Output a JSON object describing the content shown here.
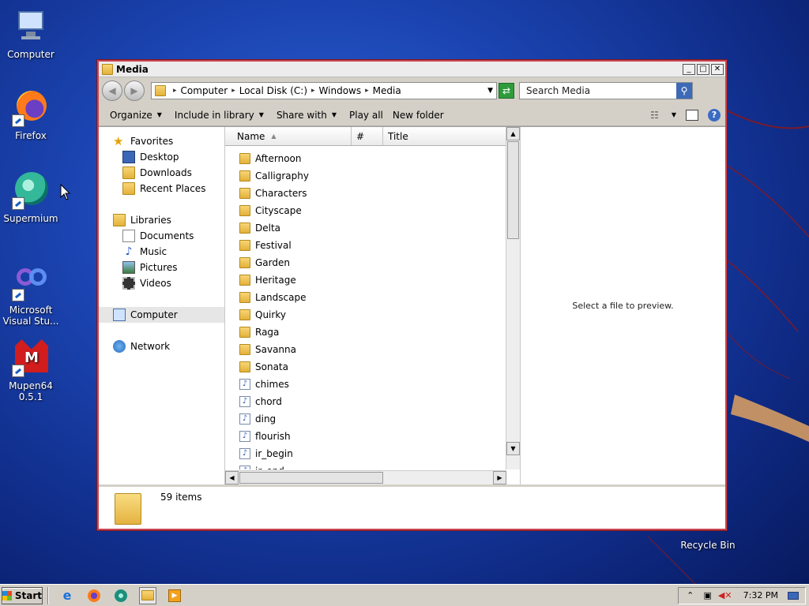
{
  "desktop": {
    "icons": [
      {
        "name": "Computer"
      },
      {
        "name": "Firefox"
      },
      {
        "name": "Supermium"
      },
      {
        "name": "Microsoft Visual Stu..."
      },
      {
        "name": "Mupen64 0.5.1"
      },
      {
        "name": "Recycle Bin"
      }
    ]
  },
  "window": {
    "title": "Media",
    "address": [
      "Computer",
      "Local Disk (C:)",
      "Windows",
      "Media"
    ],
    "search_placeholder": "Search Media",
    "commands": {
      "organize": "Organize",
      "include": "Include in library",
      "share": "Share with",
      "play_all": "Play all",
      "new_folder": "New folder"
    },
    "nav": {
      "favorites": "Favorites",
      "desktop": "Desktop",
      "downloads": "Downloads",
      "recent": "Recent Places",
      "libraries": "Libraries",
      "documents": "Documents",
      "music": "Music",
      "pictures": "Pictures",
      "videos": "Videos",
      "computer": "Computer",
      "network": "Network"
    },
    "columns": {
      "name": "Name",
      "number": "#",
      "title": "Title"
    },
    "files": [
      {
        "name": "Afternoon",
        "type": "folder"
      },
      {
        "name": "Calligraphy",
        "type": "folder"
      },
      {
        "name": "Characters",
        "type": "folder"
      },
      {
        "name": "Cityscape",
        "type": "folder"
      },
      {
        "name": "Delta",
        "type": "folder"
      },
      {
        "name": "Festival",
        "type": "folder"
      },
      {
        "name": "Garden",
        "type": "folder"
      },
      {
        "name": "Heritage",
        "type": "folder"
      },
      {
        "name": "Landscape",
        "type": "folder"
      },
      {
        "name": "Quirky",
        "type": "folder"
      },
      {
        "name": "Raga",
        "type": "folder"
      },
      {
        "name": "Savanna",
        "type": "folder"
      },
      {
        "name": "Sonata",
        "type": "folder"
      },
      {
        "name": "chimes",
        "type": "audio"
      },
      {
        "name": "chord",
        "type": "audio"
      },
      {
        "name": "ding",
        "type": "audio"
      },
      {
        "name": "flourish",
        "type": "midi"
      },
      {
        "name": "ir_begin",
        "type": "audio"
      },
      {
        "name": "ir_end",
        "type": "audio"
      }
    ],
    "preview_text": "Select a file to preview.",
    "status": "59 items"
  },
  "taskbar": {
    "start": "Start",
    "clock": "7:32 PM"
  }
}
